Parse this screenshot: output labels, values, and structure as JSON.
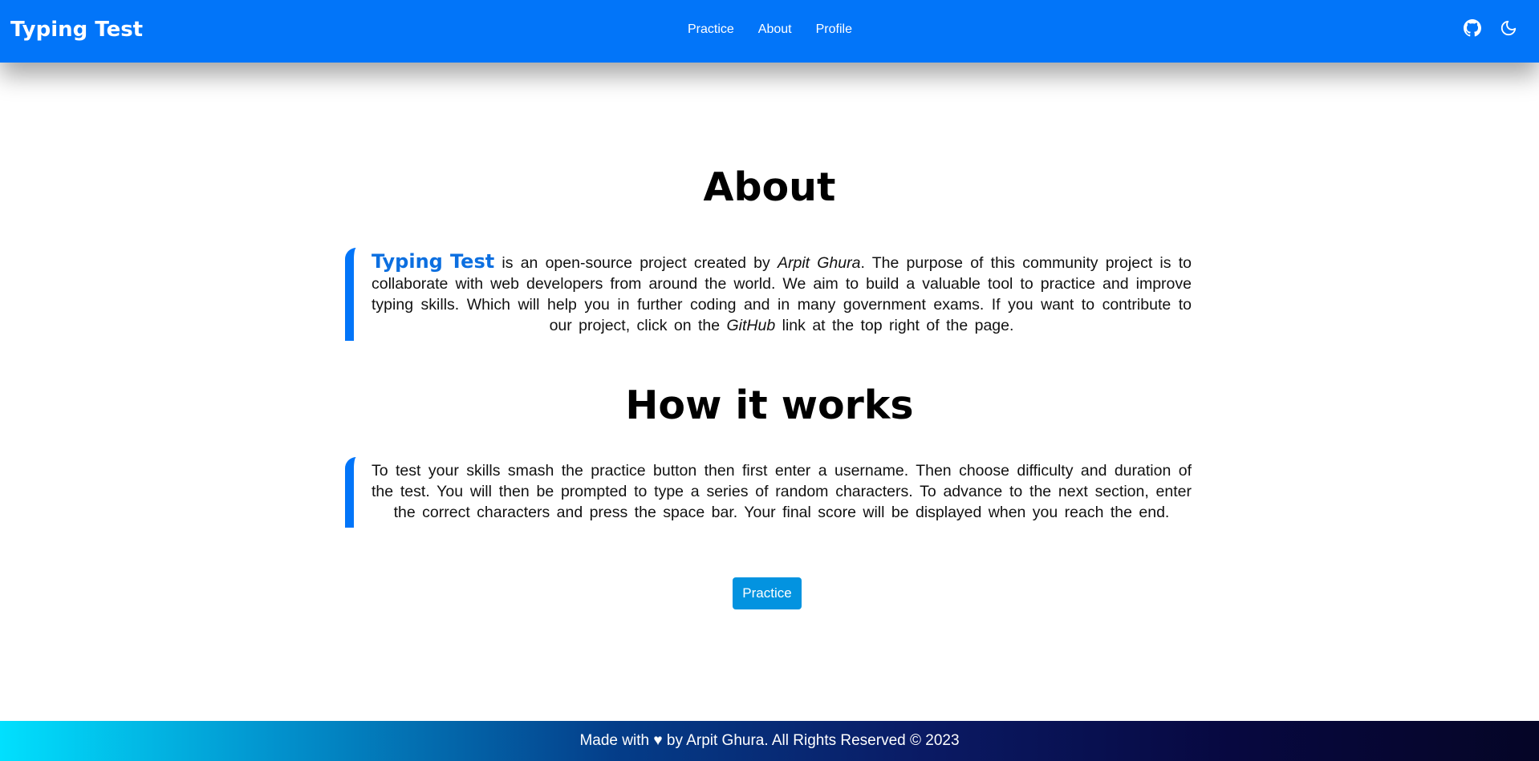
{
  "navbar": {
    "brand": "Typing Test",
    "links": [
      "Practice",
      "About",
      "Profile"
    ],
    "icons": [
      "github-icon",
      "moon-icon"
    ],
    "accent": "#0275f9"
  },
  "about": {
    "title": "About",
    "highlight": "Typing Test",
    "text_1": " is an open-source project created by ",
    "author": "Arpit Ghura",
    "text_2": ". The purpose of this community project is to collaborate with web developers from around the world. We aim to build a valuable tool to practice and improve typing skills. Which will help you in further coding and in many government exams. If you want to contribute to our project, click on the ",
    "github": "GitHub",
    "text_3": " link at the top right of the page."
  },
  "how": {
    "title": "How it works",
    "text": "To test your skills smash the practice button then first enter a username. Then choose difficulty and duration of the test. You will then be prompted to type a series of random characters. To advance to the next section, enter the correct characters and press the space bar. Your final score will be displayed when you reach the end."
  },
  "practice_button": "Practice",
  "footer": {
    "text": "Made with ♥ by Arpit Ghura. All Rights Reserved © 2023"
  }
}
